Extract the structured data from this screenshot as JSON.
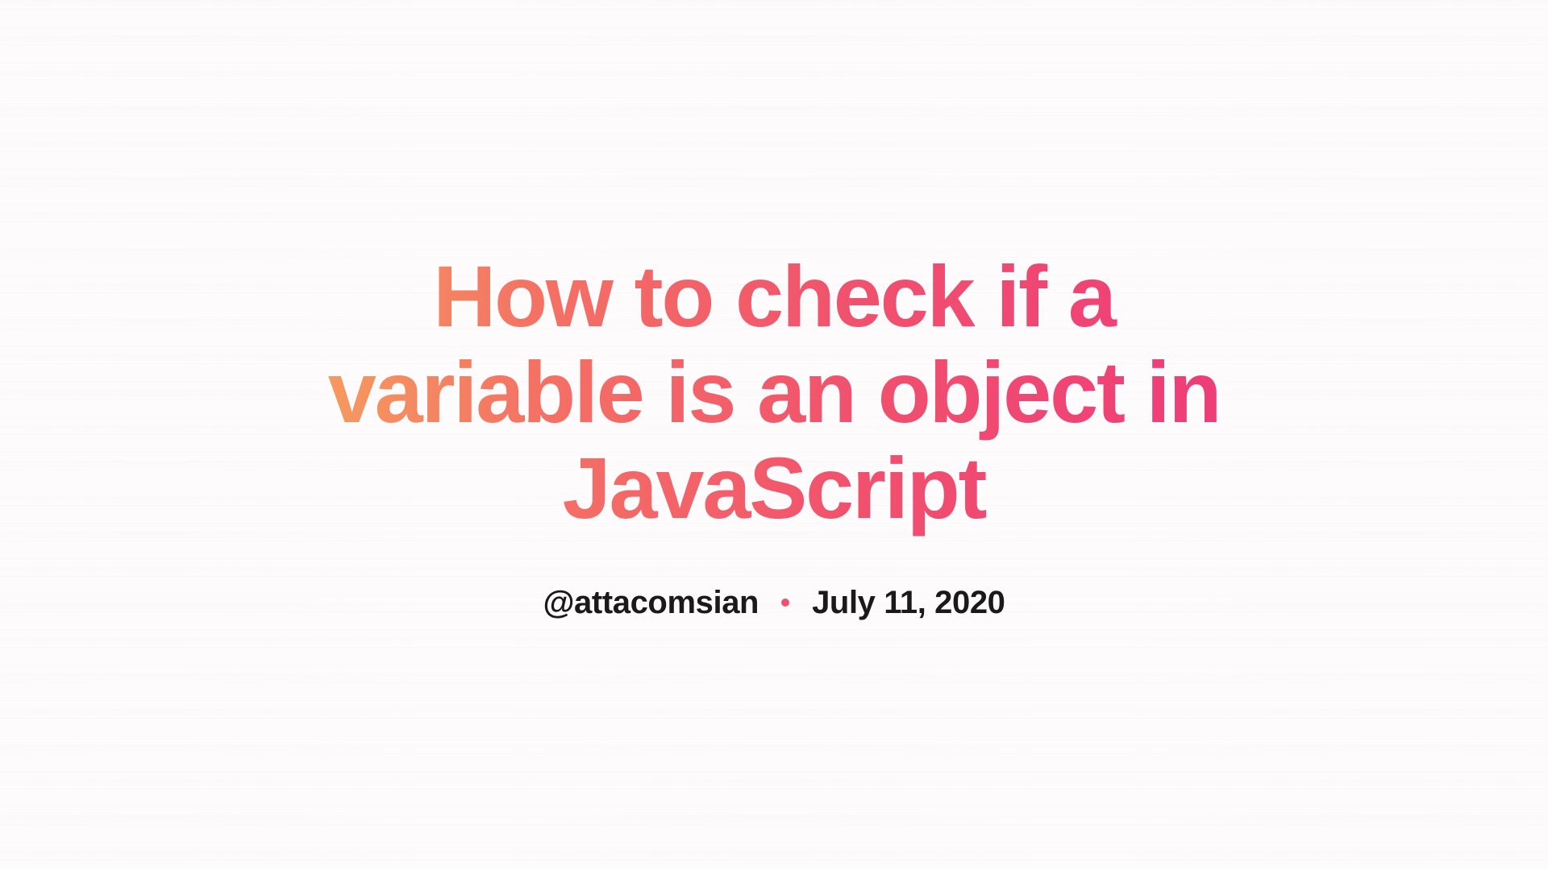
{
  "title": "How to check if a variable is an object in JavaScript",
  "author": "@attacomsian",
  "date": "July 11, 2020",
  "colors": {
    "gradientStart": "#f5a15e",
    "gradientEnd": "#ee3b7a",
    "separator": "#f0506e",
    "text": "#1a1a1a",
    "background": "#fdfbfb"
  }
}
